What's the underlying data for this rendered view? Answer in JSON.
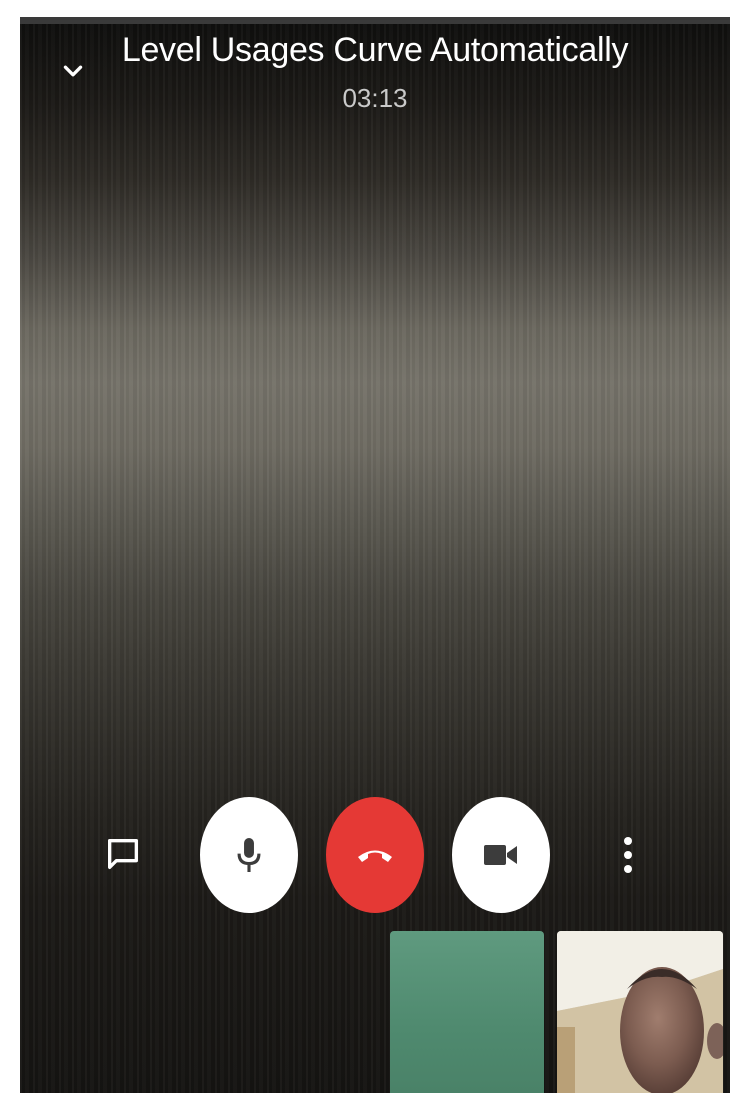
{
  "call": {
    "title": "Level Usages Curve Automatically",
    "duration": "03:13"
  },
  "icons": {
    "collapse": "chevron-down-icon",
    "chat": "chat-bubble-icon",
    "mic": "microphone-icon",
    "end_call": "phone-hangup-icon",
    "camera": "video-camera-icon",
    "more": "more-vertical-icon"
  },
  "colors": {
    "end_call": "#e53935",
    "control_bg": "#ffffff",
    "control_icon": "#3c3c3c"
  },
  "participants": [
    {
      "id": "remote",
      "preview": "green background"
    },
    {
      "id": "self",
      "preview": "camera view"
    }
  ]
}
